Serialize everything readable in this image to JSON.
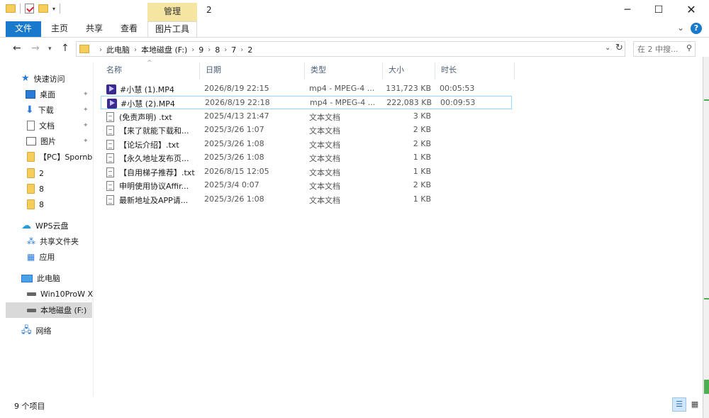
{
  "window": {
    "title": "2",
    "context_tab": "管理",
    "minimize": "─",
    "maximize": "☐",
    "close": "✕"
  },
  "ribbon": {
    "tabs": [
      {
        "label": "文件"
      },
      {
        "label": "主页"
      },
      {
        "label": "共享"
      },
      {
        "label": "查看"
      },
      {
        "label": "图片工具"
      }
    ],
    "help": "?",
    "expand": "⌄"
  },
  "address": {
    "crumbs": [
      "此电脑",
      "本地磁盘 (F:)",
      "9",
      "8",
      "7",
      "2"
    ],
    "search_placeholder": "在 2 中搜..."
  },
  "navigation": {
    "items": [
      {
        "label": "快速访问",
        "icon": "star-icon"
      },
      {
        "label": "桌面",
        "icon": "desktop-icon",
        "pinned": true
      },
      {
        "label": "下载",
        "icon": "download-icon",
        "pinned": true
      },
      {
        "label": "文档",
        "icon": "document-icon",
        "pinned": true
      },
      {
        "label": "图片",
        "icon": "pictures-icon",
        "pinned": true
      },
      {
        "label": "【PC】Spornb",
        "icon": "folder-icon"
      },
      {
        "label": "2",
        "icon": "folder-icon"
      },
      {
        "label": "8",
        "icon": "folder-icon"
      },
      {
        "label": "8",
        "icon": "folder-icon"
      },
      {
        "label": "WPS云盘",
        "icon": "cloud-icon"
      },
      {
        "label": "共享文件夹",
        "icon": "share-icon"
      },
      {
        "label": "应用",
        "icon": "apps-icon"
      },
      {
        "label": "此电脑",
        "icon": "computer-icon"
      },
      {
        "label": "Win10ProW X",
        "icon": "drive-icon"
      },
      {
        "label": "本地磁盘 (F:)",
        "icon": "drive-icon",
        "selected": true
      },
      {
        "label": "网络",
        "icon": "network-icon"
      }
    ]
  },
  "files": {
    "columns": [
      "名称",
      "日期",
      "类型",
      "大小",
      "时长"
    ],
    "rows": [
      {
        "name": "#小慧 (1).MP4",
        "date": "2026/8/19 22:15",
        "type": "mp4 - MPEG-4 ...",
        "size": "131,723 KB",
        "duration": "00:05:53",
        "icon": "video-file-icon"
      },
      {
        "name": "#小慧 (2).MP4",
        "date": "2026/8/19 22:18",
        "type": "mp4 - MPEG-4 ...",
        "size": "222,083 KB",
        "duration": "00:09:53",
        "icon": "video-file-icon",
        "selected": true
      },
      {
        "name": "(免责声明) .txt",
        "date": "2025/4/13 21:47",
        "type": "文本文档",
        "size": "3 KB",
        "duration": "",
        "icon": "text-file-icon"
      },
      {
        "name": "【来了就能下载和...",
        "date": "2025/3/26 1:07",
        "type": "文本文档",
        "size": "2 KB",
        "duration": "",
        "icon": "text-file-icon"
      },
      {
        "name": "【论坛介绍】.txt",
        "date": "2025/3/26 1:08",
        "type": "文本文档",
        "size": "2 KB",
        "duration": "",
        "icon": "text-file-icon"
      },
      {
        "name": "【永久地址发布页...",
        "date": "2025/3/26 1:08",
        "type": "文本文档",
        "size": "1 KB",
        "duration": "",
        "icon": "text-file-icon"
      },
      {
        "name": "【自用梯子推荐】.txt",
        "date": "2026/8/15 12:05",
        "type": "文本文档",
        "size": "1 KB",
        "duration": "",
        "icon": "text-file-icon"
      },
      {
        "name": "申明使用协议Affir...",
        "date": "2025/3/4 0:07",
        "type": "文本文档",
        "size": "2 KB",
        "duration": "",
        "icon": "text-file-icon"
      },
      {
        "name": "最新地址及APP请...",
        "date": "2025/3/26 1:08",
        "type": "文本文档",
        "size": "1 KB",
        "duration": "",
        "icon": "text-file-icon"
      }
    ]
  },
  "status": {
    "item_count": "9 个项目"
  },
  "colors": {
    "accent": "#1979ca",
    "context_tab": "#f4e6a1",
    "selection_border": "#99d1ff"
  }
}
